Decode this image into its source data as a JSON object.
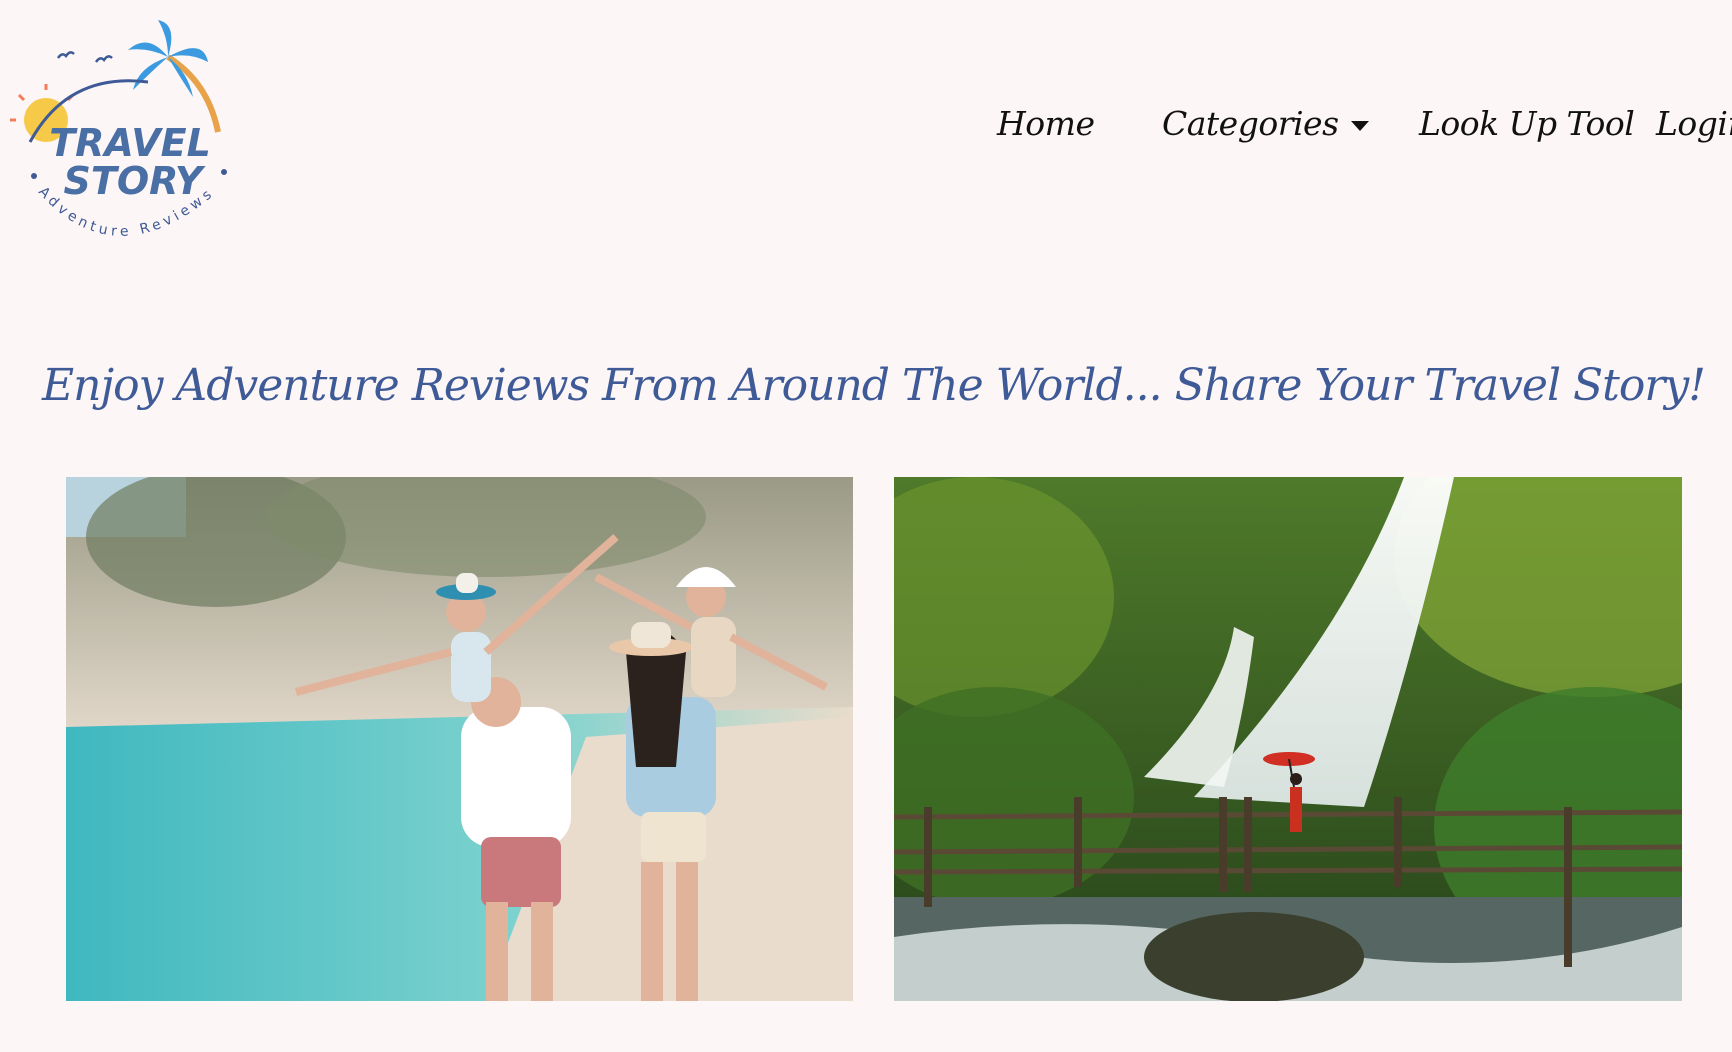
{
  "logo": {
    "line1": "TRAVEL",
    "line2": "STORY",
    "tagline": "Adventure Reviews"
  },
  "nav": {
    "home": "Home",
    "categories": "Categories",
    "lookup": "Look Up Tool",
    "login": "Login"
  },
  "headline": "Enjoy Adventure Reviews From Around The World... Share Your Travel Story!",
  "colors": {
    "background": "#fdf6f6",
    "brand_blue": "#3e5a97",
    "logo_blue": "#4a6fa5",
    "sun_yellow": "#f7c948"
  },
  "images": [
    {
      "name": "family-beach-photo"
    },
    {
      "name": "waterfall-bridge-photo"
    }
  ]
}
